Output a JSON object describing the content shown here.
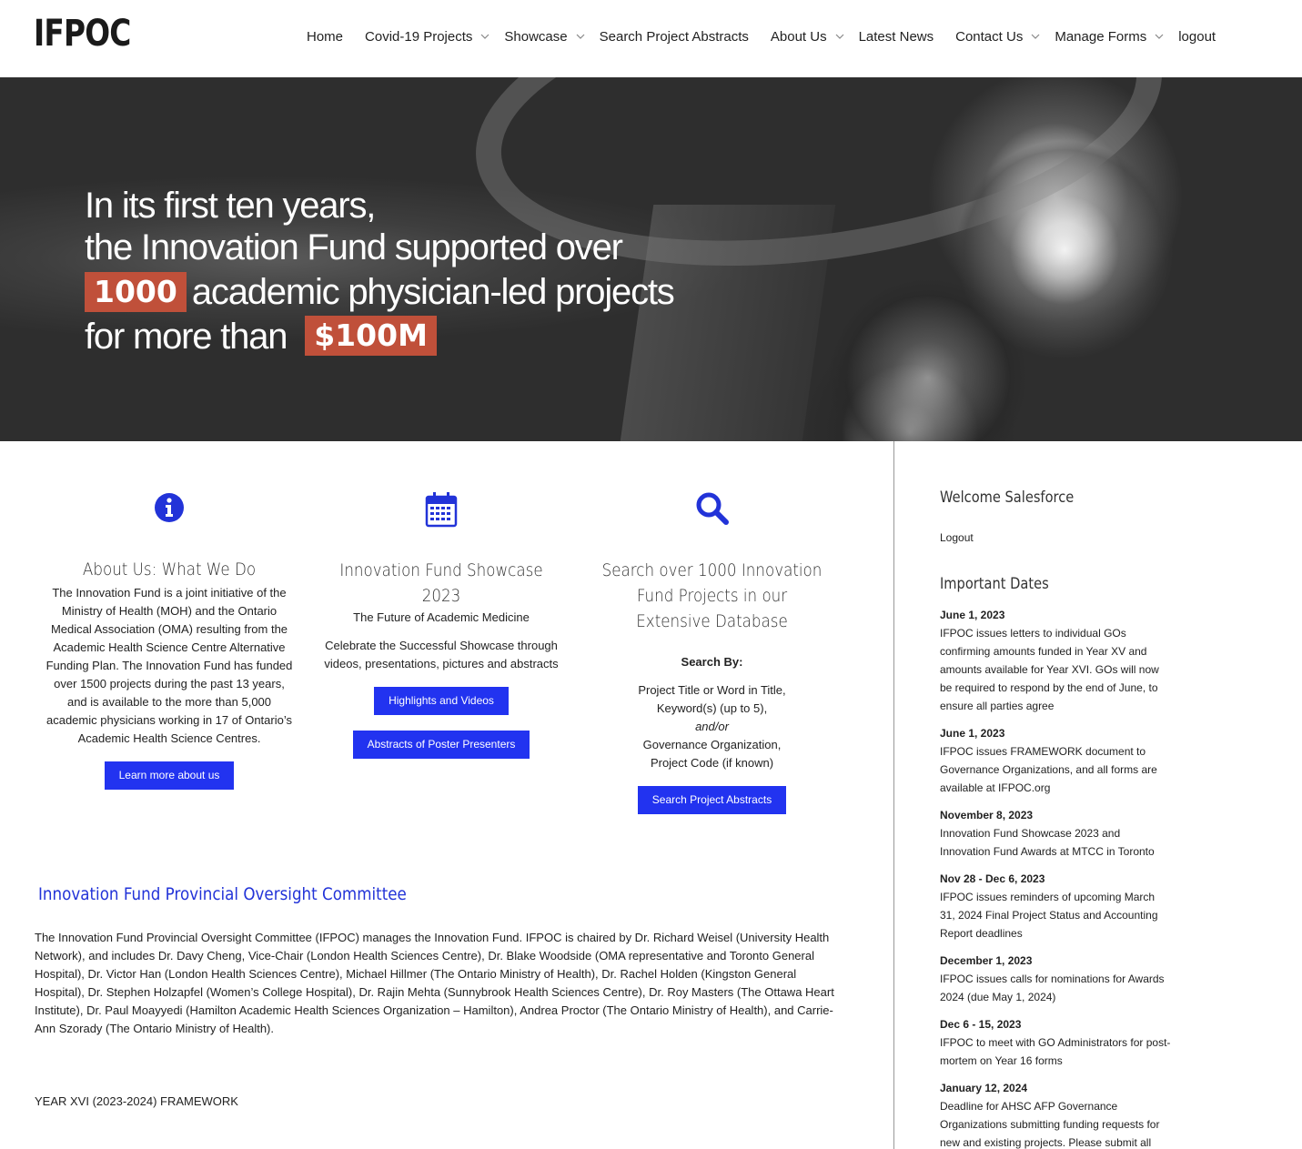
{
  "header": {
    "logo": "IFPOC",
    "nav": [
      {
        "label": "Home",
        "dropdown": false
      },
      {
        "label": "Covid-19 Projects",
        "dropdown": true
      },
      {
        "label": "Showcase",
        "dropdown": true
      },
      {
        "label": "Search Project Abstracts",
        "dropdown": false
      },
      {
        "label": "About Us",
        "dropdown": true
      },
      {
        "label": "Latest News",
        "dropdown": false
      },
      {
        "label": "Contact Us",
        "dropdown": true
      },
      {
        "label": "Manage Forms",
        "dropdown": true
      },
      {
        "label": "logout",
        "dropdown": false
      }
    ]
  },
  "hero": {
    "line1": "In its first ten years,",
    "line2": "the Innovation Fund supported over",
    "highlight1": "1000",
    "line3_rest": "academic physician-led projects",
    "line4_pre": "for more than",
    "highlight2": "$100M",
    "highlight_color": "#c0503a"
  },
  "about": {
    "icon": "info-icon",
    "title": "About Us: What We Do",
    "text": "The Innovation Fund is a joint initiative of the Ministry of Health (MOH) and the Ontario Medical Association (OMA) resulting from the Academic Health Science Centre Alternative Funding Plan. The Innovation Fund has funded over 1500 projects during the past 13 years, and is available to the more than 5,000 academic physicians working in 17 of Ontario’s Academic Health Science Centres.",
    "button": "Learn more about us"
  },
  "showcase": {
    "icon": "calendar-icon",
    "title": "Innovation Fund Showcase 2023",
    "subtitle": "The Future of Academic Medicine",
    "text": "Celebrate the Successful Showcase through videos, presentations, pictures and abstracts",
    "button1": "Highlights and Videos",
    "button2": "Abstracts of Poster Presenters"
  },
  "search": {
    "icon": "search-icon",
    "title": "Search over 1000 Innovation Fund Projects in our Extensive Database",
    "search_by": "Search By:",
    "line1": "Project Title or Word in Title,",
    "line2": "Keyword(s) (up to 5),",
    "andor": "and/or",
    "line3": "Governance Organization,",
    "line4": "Project Code (if known)",
    "button": "Search Project Abstracts"
  },
  "committee": {
    "title": "Innovation Fund Provincial Oversight Committee",
    "text": "The Innovation Fund Provincial Oversight Committee (IFPOC) manages the Innovation Fund.  IFPOC is chaired by Dr. Richard Weisel (University Health Network), and includes Dr. Davy Cheng, Vice-Chair (London Health Sciences Centre), Dr. Blake Woodside (OMA representative and Toronto General Hospital), Dr. Victor Han (London Health Sciences Centre), Michael Hillmer (The Ontario Ministry of Health), Dr. Rachel Holden (Kingston General Hospital), Dr. Stephen Holzapfel (Women’s College Hospital), Dr. Rajin Mehta (Sunnybrook Health Sciences Centre), Dr. Roy Masters (The Ottawa Heart Institute), Dr. Paul Moayyedi (Hamilton Academic Health Sciences Organization – Hamilton), Andrea Proctor (The Ontario Ministry of Health), and Carrie-Ann Szorady (The Ontario Ministry of Health).",
    "framework": "YEAR XVI (2023-2024) FRAMEWORK"
  },
  "sidebar": {
    "welcome": "Welcome Salesforce",
    "logout": "Logout",
    "dates_title": "Important Dates",
    "dates": [
      {
        "date": "June 1, 2023",
        "text": "IFPOC issues letters to individual GOs confirming amounts funded in Year XV and amounts available for Year XVI. GOs will now be required to respond by the end of June, to ensure all parties agree"
      },
      {
        "date": "June 1, 2023",
        "text": "IFPOC issues FRAMEWORK document to Governance Organizations, and all forms are available at IFPOC.org"
      },
      {
        "date": "November 8, 2023",
        "text": "Innovation Fund Showcase 2023 and Innovation Fund Awards at MTCC in Toronto"
      },
      {
        "date": "Nov 28 - Dec 6, 2023",
        "text": "IFPOC issues reminders of upcoming March 31, 2024 Final Project Status and Accounting Report deadlines"
      },
      {
        "date": "December 1, 2023",
        "text": "IFPOC issues calls for nominations for Awards 2024 (due May 1, 2024)"
      },
      {
        "date": "Dec 6 - 15, 2023",
        "text": "IFPOC to meet with GO Administrators for post-mortem on Year 16 forms"
      },
      {
        "date": "January 12, 2024",
        "text": "Deadline for AHSC AFP Governance Organizations submitting funding requests for new and existing projects. Please submit all"
      }
    ]
  },
  "colors": {
    "accent_blue": "#2233f0",
    "icon_blue": "#2233d8"
  }
}
